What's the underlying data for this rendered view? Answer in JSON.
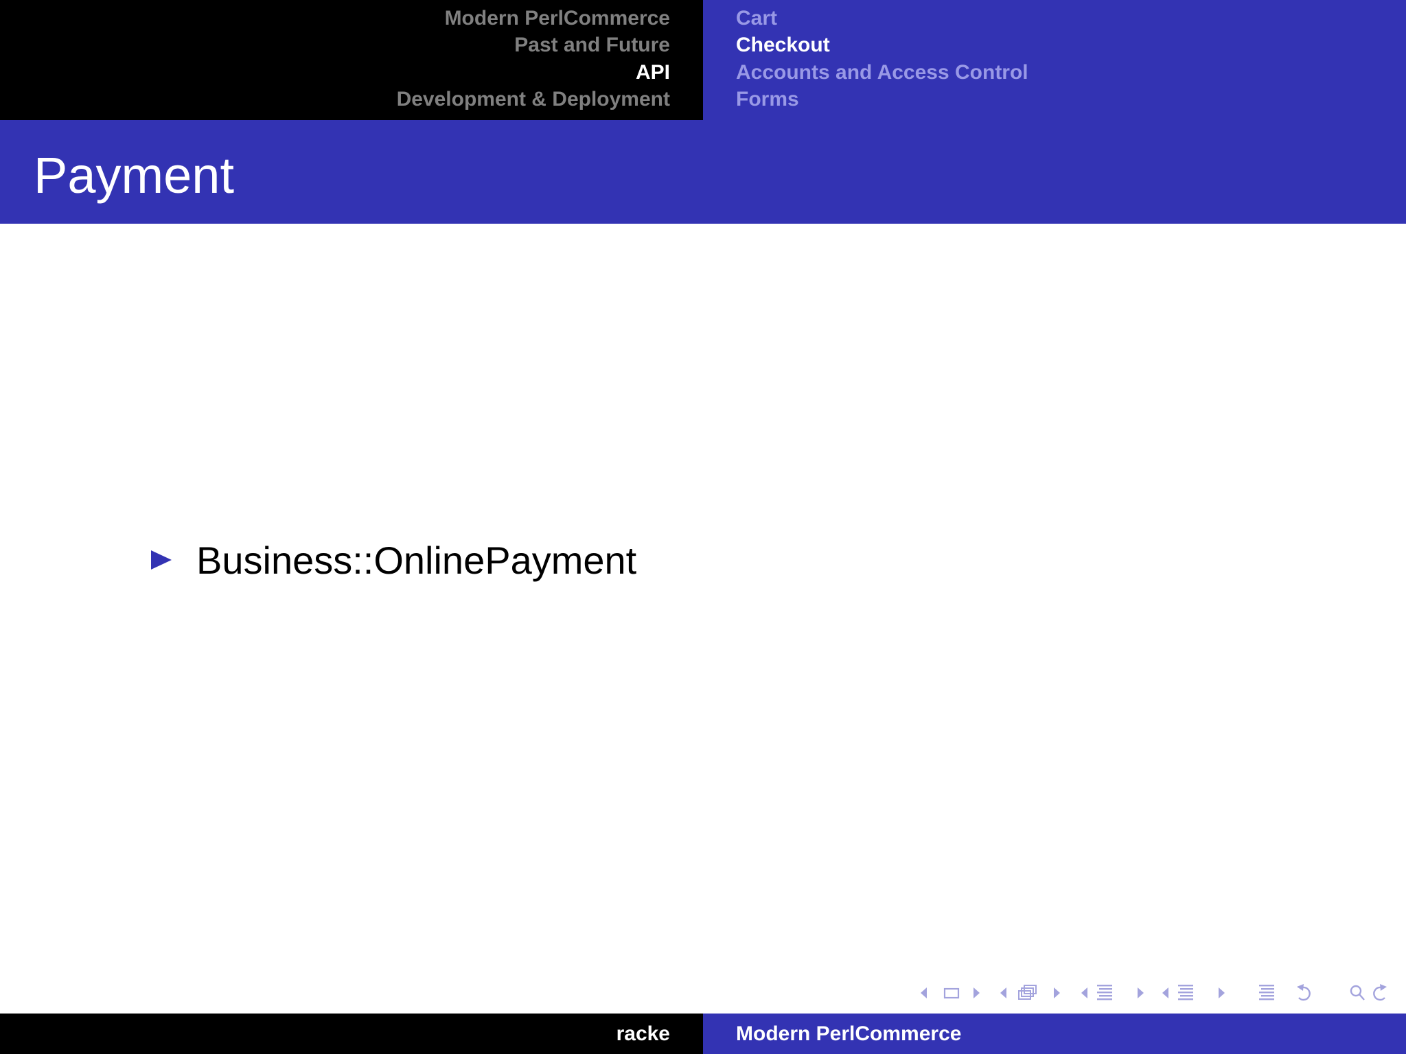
{
  "header": {
    "sections": [
      {
        "label": "Modern PerlCommerce",
        "active": false
      },
      {
        "label": "Past and Future",
        "active": false
      },
      {
        "label": "API",
        "active": true
      },
      {
        "label": "Development & Deployment",
        "active": false
      }
    ],
    "subsections": [
      {
        "label": "Cart",
        "active": false
      },
      {
        "label": "Checkout",
        "active": true
      },
      {
        "label": "Accounts and Access Control",
        "active": false
      },
      {
        "label": "Forms",
        "active": false
      }
    ]
  },
  "frame": {
    "title": "Payment",
    "bullets": [
      "Business::OnlinePayment"
    ]
  },
  "footer": {
    "author": "racke",
    "title": "Modern PerlCommerce"
  },
  "navigation_symbols": [
    "previous-slide-icon",
    "slide-icon",
    "next-slide-icon",
    "previous-frame-icon",
    "frame-icon",
    "next-frame-icon",
    "previous-subsection-icon",
    "subsection-icon",
    "next-subsection-icon",
    "previous-section-icon",
    "section-icon",
    "next-section-icon",
    "document-icon",
    "back-icon",
    "search-icon",
    "forward-icon"
  ],
  "colors": {
    "structure": "#3333b3",
    "header_dark": "#000000",
    "inactive_section": "#808080",
    "inactive_subsection": "#9999e6",
    "nav_symbols": "#a3a3dd"
  }
}
